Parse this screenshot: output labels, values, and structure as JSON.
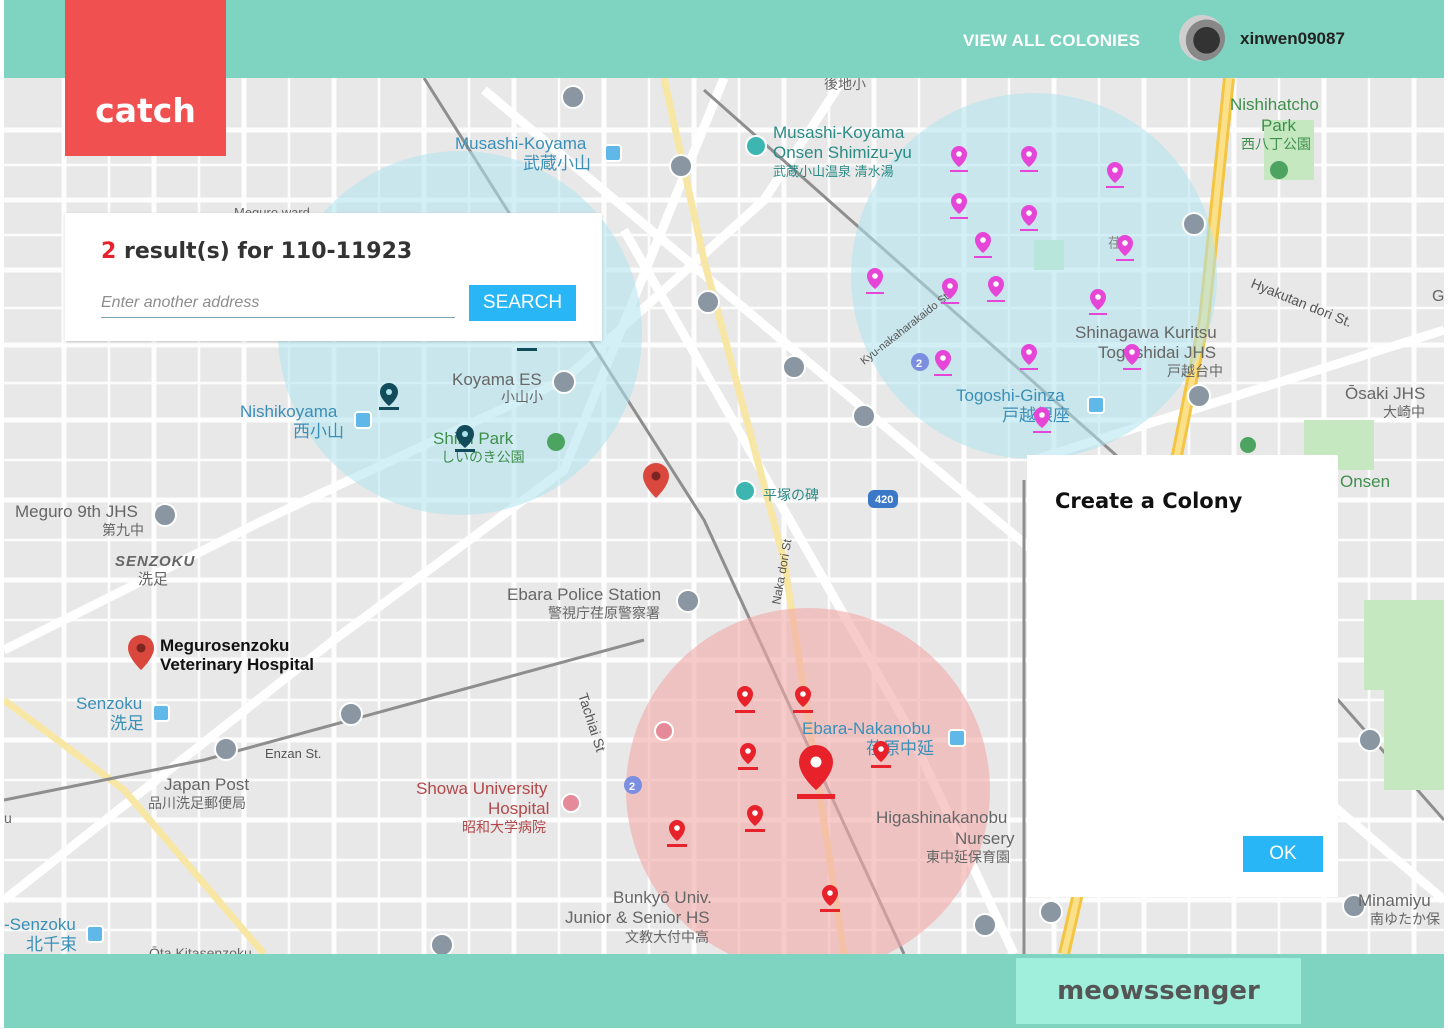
{
  "colors": {
    "header": "#7ed3c1",
    "logo": "#f05050",
    "accent": "#29b6f6",
    "count": "#e8222a",
    "meow_button": "#a0eedc",
    "colony_blue": "#bfe6ef",
    "colony_red": "#f1b8b8",
    "pin_magenta": "#e646d8",
    "pin_red": "#e8222a",
    "pin_dark": "#124c5b"
  },
  "header": {
    "logo": "catch",
    "nav_link": "VIEW ALL COLONIES",
    "username": "xinwen09087"
  },
  "search": {
    "count": "2",
    "result_text": " result(s) for 110-11923",
    "placeholder": "Enter another address",
    "button": "SEARCH"
  },
  "colony_dialog": {
    "title": "Create a Colony",
    "ok": "OK"
  },
  "footer": {
    "button": "meowssenger"
  },
  "map": {
    "labels": {
      "musashi_koyama": "Musashi-Koyama",
      "musashi_koyama_jp": "武蔵小山",
      "onsen1": "Musashi-Koyama",
      "onsen2": "Onsen Shimizu-yu",
      "onsen_jp": "武蔵小山温泉 清水湯",
      "nishihatcho1": "Nishihatcho",
      "nishihatcho2": "Park",
      "nishihatcho_jp": "西八丁公園",
      "goji": "後地小",
      "hyakutan": "Hyakutan dori St.",
      "kyu": "Kyu-nakaharakaido St.",
      "kuritsu": "Shinagawa Kuritsu",
      "togoshidai": "Togoshidai JHS",
      "togoshidai_jp": "戸越台中",
      "togoshi_ginza": "Togoshi-Ginza",
      "togoshi_ginza_jp": "戸越銀座",
      "osaki": "Ōsaki JHS",
      "osaki_jp": "大崎中",
      "onsen_edge": "Onsen",
      "ga": "Ga",
      "nishikoyama": "Nishikoyama",
      "nishikoyama_jp": "西小山",
      "koyama_es": "Koyama ES",
      "koyama_es_jp": "小山小",
      "shiiki": "Shiiki Park",
      "shiiki_jp": "しいのき公園",
      "meguro_ward": "Meguro ward",
      "meguro9": "Meguro 9th JHS",
      "meguro9_jp": "第九中",
      "senzoku_area": "SENZOKU",
      "senzoku_area_jp": "洗足",
      "hiratsuka": "平塚の碑",
      "route": "420",
      "nakadori": "Naka dori St",
      "ebara_police": "Ebara Police Station",
      "ebara_police_jp": "警視庁荏原警察署",
      "vet1": "Megurosenzoku",
      "vet2": "Veterinary Hospital",
      "senzoku": "Senzoku",
      "senzoku_jp": "洗足",
      "enzan": "Enzan St.",
      "japan_post": "Japan Post",
      "japan_post_jp": "品川洗足郵便局",
      "tachiai": "Tachiai St",
      "showa1": "Showa University",
      "showa2": "Hospital",
      "showa_jp": "昭和大学病院",
      "ebara_nakanobu": "Ebara-Nakanobu",
      "ebara_nakanobu_jp": "荏原中延",
      "higashi1": "Higashinakanobu",
      "higashi2": "Nursery",
      "higashi_jp": "東中延保育園",
      "bunkyo1": "Bunkyō Univ.",
      "bunkyo2": "Junior & Senior HS",
      "bunkyo_jp": "文教大付中高",
      "kitasenzoku": "-Senzoku",
      "kitasenzoku_jp": "北千束",
      "okitasenzoku": "Ōta Kitasenzoku",
      "minamiyu": "Minamiyu",
      "minamiyu_jp": "南ゆたか保",
      "edge_u": "u",
      "route2": "2",
      "route2b": "2",
      "so": "荏"
    }
  }
}
